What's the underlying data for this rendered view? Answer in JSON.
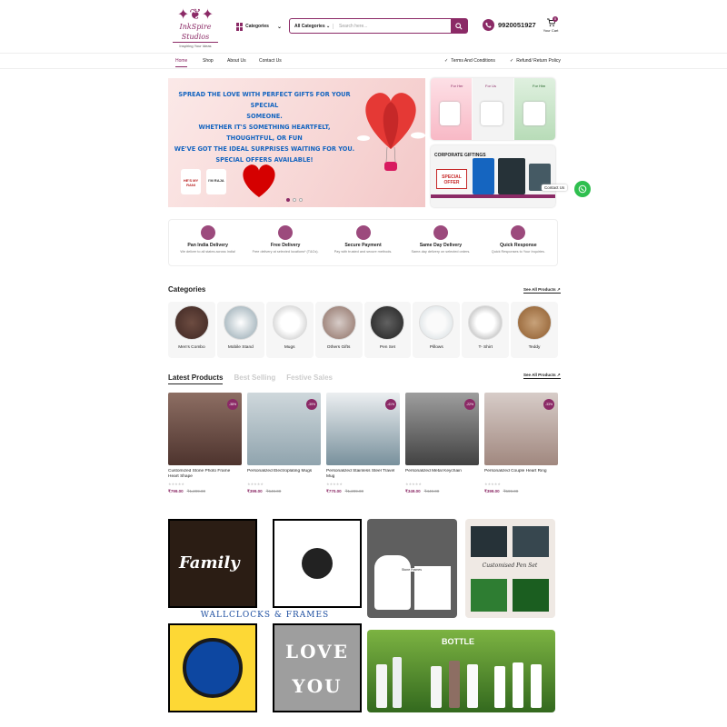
{
  "header": {
    "logo_name": "InkSpire Studios",
    "logo_tagline": "Inspiring Your Ideas",
    "categories_label": "Categories",
    "search_category": "All Categories",
    "search_placeholder": "Search here...",
    "phone": "9920051927",
    "cart_label": "Your Cart",
    "cart_count": "0"
  },
  "nav": {
    "items": [
      "Home",
      "Shop",
      "About Us",
      "Contact Us"
    ],
    "policies": [
      "Terms And Conditions",
      "Refund/ Return Policy"
    ]
  },
  "hero": {
    "text_lines": [
      "SPREAD THE LOVE WITH PERFECT GIFTS FOR YOUR SPECIAL",
      "SOMEONE.",
      "WHETHER IT'S SOMETHING HEARTFELT, THOUGHTFUL, OR FUN",
      "WE'VE GOT THE IDEAL SURPRISES WAITING FOR YOU.",
      "SPECIAL OFFERS AVAILABLE!"
    ],
    "mug1": "HE'S MY RANI",
    "mug2": "I'M RAJA"
  },
  "side_banner1": {
    "labels": [
      "For Her",
      "For Us",
      "For Him"
    ]
  },
  "side_banner2": {
    "title": "CORPORATE GIFTINGS",
    "offer": "SPECIAL OFFER"
  },
  "whatsapp_label": "Contact Us",
  "features": [
    {
      "title": "Pan India Delivery",
      "desc": "We deliver to all states across India!"
    },
    {
      "title": "Free Delivery",
      "desc": "Free delivery at selected locations* (T&Cs)."
    },
    {
      "title": "Secure Payment",
      "desc": "Pay with trusted and secure methods."
    },
    {
      "title": "Same Day Delivery",
      "desc": "Same-day delivery on selected orders."
    },
    {
      "title": "Quick Response",
      "desc": "Quick Responses to Your Inquiries."
    }
  ],
  "categories": {
    "title": "Categories",
    "see_all": "See All Products",
    "items": [
      "Men's Combo",
      "Mobile Stand",
      "Mugs",
      "Others Gifts",
      "Pen Set",
      "Pillows",
      "T- Shirt",
      "Teddy"
    ]
  },
  "products": {
    "tabs": [
      "Latest Products",
      "Best Selling",
      "Festive Sales"
    ],
    "see_all": "See All Products",
    "items": [
      {
        "name": "Customized Stone Photo Frame Heart Shape",
        "price": "₹799.00",
        "old": "₹1,299.00",
        "discount": "-38%"
      },
      {
        "name": "Personalized Electroplating Mugs",
        "price": "₹399.00",
        "old": "₹649.00",
        "discount": "-39%"
      },
      {
        "name": "Personalized Stainless Steel Travel Mug",
        "price": "₹770.00",
        "old": "₹1,299.00",
        "discount": "-41%"
      },
      {
        "name": "Personalized Metal Keychain",
        "price": "₹349.00",
        "old": "₹449.00",
        "discount": "-22%"
      },
      {
        "name": "Personalized Couple Heart Ring",
        "price": "₹399.00",
        "old": "₹599.00",
        "discount": "-33%"
      }
    ]
  },
  "promo": {
    "wallclock_title": "WALLCLOCKS & FRAMES",
    "family_text": "Family",
    "stone_label": "Stone Frames",
    "penset_label": "Customised Pen Set",
    "bottle_label": "BOTTLE",
    "love_you": "LOVE YOU"
  },
  "colors": {
    "brand": "#8b2a66",
    "hero_text": "#1565c0",
    "whatsapp": "#2fbf4f"
  }
}
